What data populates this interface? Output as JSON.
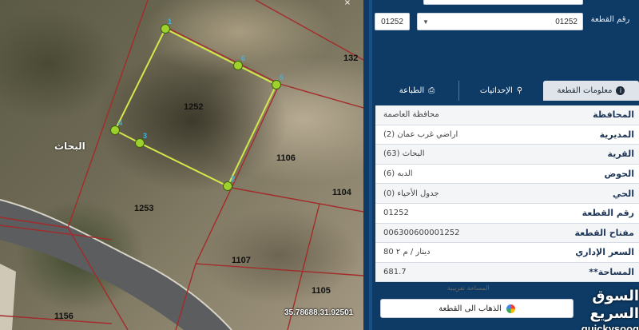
{
  "map": {
    "parcels": [
      {
        "id": "main",
        "label": "1252"
      },
      {
        "id": "e",
        "label": "1106"
      },
      {
        "id": "ee",
        "label": "1104"
      },
      {
        "id": "sw",
        "label": "1253"
      },
      {
        "id": "s",
        "label": "1107"
      },
      {
        "id": "se",
        "label": "1105"
      },
      {
        "id": "ssw",
        "label": "1156"
      },
      {
        "id": "ne",
        "label": "132"
      }
    ],
    "vertices": [
      "1",
      "2",
      "3",
      "4",
      "5",
      "6"
    ],
    "place_name": "البحاث",
    "coordinates": "35.78688,31.92501",
    "colors": {
      "boundary": "#d4e84a",
      "lines": "#a32b2b"
    }
  },
  "panel": {
    "plot_number_value": "01252",
    "plot_select_value": "01252",
    "plot_label": "رقم القطعة",
    "tabs": [
      {
        "label": "معلومات القطعة",
        "icon": "info-icon",
        "active": true
      },
      {
        "label": "الإحداثيات",
        "icon": "pin-icon",
        "active": false
      },
      {
        "label": "الطباعة",
        "icon": "printer-icon",
        "active": false
      }
    ],
    "info": [
      {
        "label": "المحافظة",
        "value": "محافظة العاصمة"
      },
      {
        "label": "المديرية",
        "value": "اراضي غرب عمان (2)"
      },
      {
        "label": "القرية",
        "value": "البحاث (63)"
      },
      {
        "label": "الحوض",
        "value": "الدبه (6)"
      },
      {
        "label": "الحي",
        "value": "جدول الأحياء (0)"
      },
      {
        "label": "رقم القطعة",
        "value": "01252"
      },
      {
        "label": "مفتاح القطعة",
        "value": "006300600001252"
      },
      {
        "label": "السعر الإداري",
        "value": "80 دينار / م ٢"
      },
      {
        "label": "**المساحة",
        "value": "681.7"
      }
    ],
    "note": "المساحة تقريبية",
    "goto_label": "الذهاب الى القطعة"
  },
  "watermark": {
    "arabic": "السوق السريع",
    "latin": "quickysooq"
  }
}
